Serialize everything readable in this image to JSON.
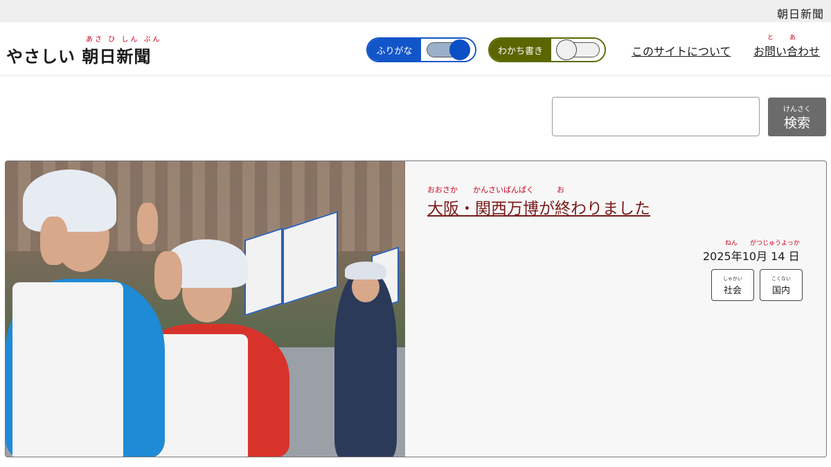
{
  "topbar": {
    "brand": "朝日新聞"
  },
  "header": {
    "logo_ruby": "あさ ひ しん ぶん",
    "logo_text": "やさしい 朝日新聞",
    "furigana_toggle": {
      "label": "ふりがな",
      "state": "on"
    },
    "wakachi_toggle": {
      "label": "わかち書き",
      "state": "off"
    },
    "nav": {
      "about": "このサイトについて",
      "contact_ruby_to": "と",
      "contact_ruby_a": "あ",
      "contact": "お問い合わせ"
    }
  },
  "search": {
    "placeholder": "",
    "button_ruby": "けんさく",
    "button_label": "検索"
  },
  "article": {
    "title_ruby": "おおさか　　かんさいばんぱく　　　お",
    "title": "大阪・関西万博が終わりました",
    "date_ruby": "ねん　　がつじゅうよっか",
    "date": "2025年10月 14 日",
    "tags": [
      {
        "ruby": "しゃかい",
        "label": "社会"
      },
      {
        "ruby": "こくない",
        "label": "国内"
      }
    ]
  },
  "colors": {
    "furigana_accent": "#1255c8",
    "wakachi_accent": "#5c6600",
    "ruby": "#c8001e",
    "title": "#7a1a1a",
    "search_button": "#6b6b6b"
  }
}
